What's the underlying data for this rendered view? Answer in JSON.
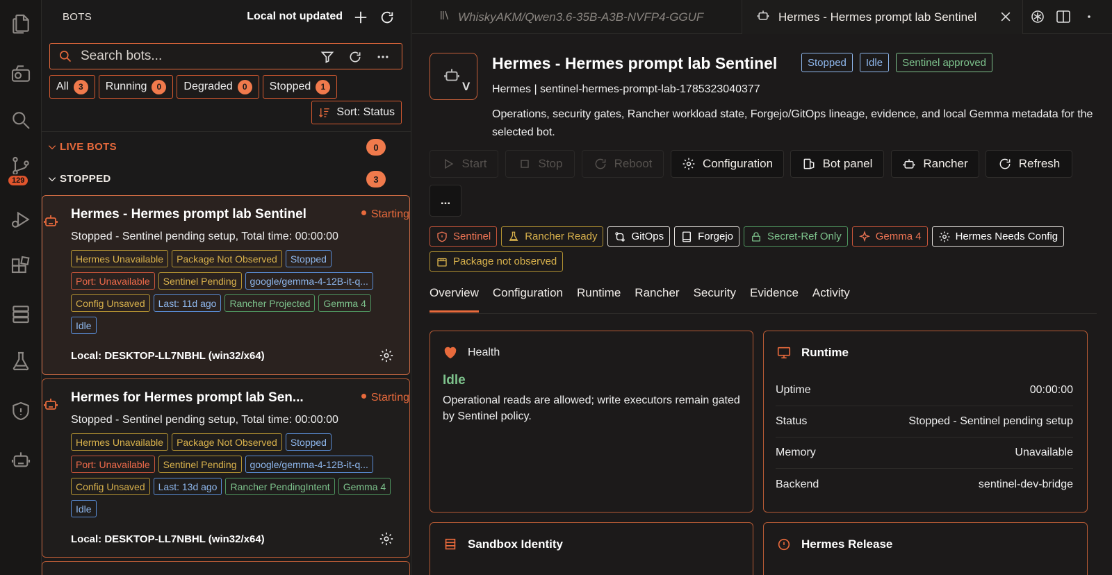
{
  "activity_bar": {
    "icons": [
      "files-icon",
      "remote-explorer-icon",
      "search-icon",
      "source-control-icon",
      "run-debug-icon",
      "extensions-icon",
      "database-icon",
      "lab-flask-icon",
      "shield-icon",
      "bot-icon"
    ],
    "source_control_badge": "129"
  },
  "sidebar": {
    "title": "BOTS",
    "status": "Local not updated",
    "search": {
      "placeholder": "Search bots..."
    },
    "filters": [
      {
        "label": "All",
        "count": "3"
      },
      {
        "label": "Running",
        "count": "0"
      },
      {
        "label": "Degraded",
        "count": "0"
      },
      {
        "label": "Stopped",
        "count": "1"
      }
    ],
    "sort_label": "Sort: Status",
    "groups": [
      {
        "label": "LIVE BOTS",
        "count": "0",
        "color": "#e86a3c"
      },
      {
        "label": "STOPPED",
        "count": "3",
        "color": "#f0ebe6"
      }
    ],
    "cards": [
      {
        "title": "Hermes - Hermes prompt lab Sentinel",
        "state": "Starting",
        "subtitle": "Stopped - Sentinel pending setup, Total time: 00:00:00",
        "tags": [
          {
            "text": "Hermes Unavailable",
            "tone": "yel"
          },
          {
            "text": "Package Not Observed",
            "tone": "yel"
          },
          {
            "text": "Stopped",
            "tone": "blu"
          },
          {
            "text": "Port: Unavailable",
            "tone": "red"
          },
          {
            "text": "Sentinel Pending",
            "tone": "yel"
          },
          {
            "text": "google/gemma-4-12B-it-q...",
            "tone": "blu"
          },
          {
            "text": "Config Unsaved",
            "tone": "yel"
          },
          {
            "text": "Last: 11d ago",
            "tone": "blu"
          },
          {
            "text": "Rancher Projected",
            "tone": "grn"
          },
          {
            "text": "Gemma 4",
            "tone": "grn"
          },
          {
            "text": "Idle",
            "tone": "blu"
          }
        ],
        "footer": "Local: DESKTOP-LL7NBHL (win32/x64)"
      },
      {
        "title": "Hermes for Hermes prompt lab Sen...",
        "state": "Starting",
        "subtitle": "Stopped - Sentinel pending setup, Total time: 00:00:00",
        "tags": [
          {
            "text": "Hermes Unavailable",
            "tone": "yel"
          },
          {
            "text": "Package Not Observed",
            "tone": "yel"
          },
          {
            "text": "Stopped",
            "tone": "blu"
          },
          {
            "text": "Port: Unavailable",
            "tone": "red"
          },
          {
            "text": "Sentinel Pending",
            "tone": "yel"
          },
          {
            "text": "google/gemma-4-12B-it-q...",
            "tone": "blu"
          },
          {
            "text": "Config Unsaved",
            "tone": "yel"
          },
          {
            "text": "Last: 13d ago",
            "tone": "blu"
          },
          {
            "text": "Rancher PendingIntent",
            "tone": "grn"
          },
          {
            "text": "Gemma 4",
            "tone": "grn"
          },
          {
            "text": "Idle",
            "tone": "blu"
          }
        ],
        "footer": "Local: DESKTOP-LL7NBHL (win32/x64)"
      }
    ]
  },
  "tabs": [
    {
      "label": "WhiskyAKM/Qwen3.6-35B-A3B-NVFP4-GGUF",
      "active": false
    },
    {
      "label": "Hermes - Hermes prompt lab Sentinel",
      "active": true
    }
  ],
  "detail": {
    "title": "Hermes - Hermes prompt lab Sentinel",
    "badges": [
      {
        "text": "Stopped",
        "tone": "blu"
      },
      {
        "text": "Idle",
        "tone": "blu"
      },
      {
        "text": "Sentinel approved",
        "tone": "grn"
      }
    ],
    "icon_letter": "V",
    "subtitle": "Hermes | sentinel-hermes-prompt-lab-1785323040377",
    "description": "Operations, security gates, Rancher workload state, Forgejo/GitOps lineage, evidence, and local Gemma metadata for the selected bot.",
    "actions": {
      "start": "Start",
      "stop": "Stop",
      "reboot": "Reboot",
      "configuration": "Configuration",
      "bot_panel": "Bot panel",
      "rancher": "Rancher",
      "refresh": "Refresh",
      "more": "..."
    },
    "chips": [
      {
        "text": "Sentinel",
        "tone": "red",
        "icon": "shield-icon"
      },
      {
        "text": "Rancher Ready",
        "tone": "yel",
        "icon": "flask-icon"
      },
      {
        "text": "GitOps",
        "tone": "wht",
        "icon": "git-compare-icon"
      },
      {
        "text": "Forgejo",
        "tone": "wht",
        "icon": "book-icon"
      },
      {
        "text": "Secret-Ref Only",
        "tone": "grn",
        "icon": "lock-icon"
      },
      {
        "text": "Gemma 4",
        "tone": "red",
        "icon": "sparkle-icon"
      },
      {
        "text": "Hermes Needs Config",
        "tone": "wht",
        "icon": "gear-icon"
      },
      {
        "text": "Package not observed",
        "tone": "yel",
        "icon": "package-icon"
      }
    ],
    "detail_tabs": [
      "Overview",
      "Configuration",
      "Runtime",
      "Rancher",
      "Security",
      "Evidence",
      "Activity"
    ],
    "active_tab": "Overview",
    "health": {
      "title": "Health",
      "state": "Idle",
      "text": "Operational reads are allowed; write executors remain gated by Sentinel policy."
    },
    "runtime": {
      "title": "Runtime",
      "rows": [
        {
          "label": "Uptime",
          "value": "00:00:00"
        },
        {
          "label": "Status",
          "value": "Stopped - Sentinel pending setup"
        },
        {
          "label": "Memory",
          "value": "Unavailable"
        },
        {
          "label": "Backend",
          "value": "sentinel-dev-bridge"
        }
      ]
    },
    "sandbox_title": "Sandbox Identity",
    "release_title": "Hermes Release"
  },
  "colors": {
    "accent": "#e86a3c",
    "background": "#1c1a1a",
    "ok_green": "#7dc28c",
    "info_blue": "#8fb8ee",
    "warn_yellow": "#d9b24c"
  }
}
